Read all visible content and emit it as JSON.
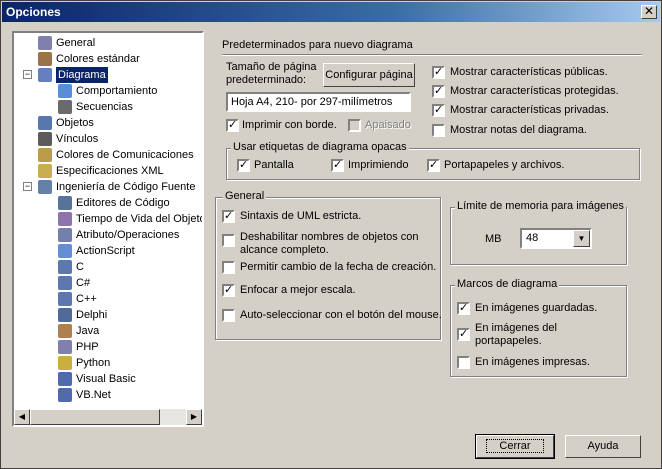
{
  "window": {
    "title": "Opciones",
    "close_glyph": "✕"
  },
  "tree": {
    "items": [
      {
        "label": "General",
        "icon": "general-icon"
      },
      {
        "label": "Colores estándar",
        "icon": "colors-icon"
      },
      {
        "label": "Diagrama",
        "icon": "diagram-icon"
      },
      {
        "label": "Comportamiento",
        "icon": "behavior-icon"
      },
      {
        "label": "Secuencias",
        "icon": "sequence-icon"
      },
      {
        "label": "Objetos",
        "icon": "objects-icon"
      },
      {
        "label": "Vínculos",
        "icon": "links-icon"
      },
      {
        "label": "Colores de Comunicaciones",
        "icon": "comm-colors-icon"
      },
      {
        "label": "Especificaciones XML",
        "icon": "xml-icon"
      },
      {
        "label": "Ingeniería de Código Fuente",
        "icon": "code-eng-icon"
      },
      {
        "label": "Editores de Código",
        "icon": "code-editor-icon"
      },
      {
        "label": "Tiempo de Vida del Objeto",
        "icon": "lifetime-icon"
      },
      {
        "label": "Atributo/Operaciones",
        "icon": "attributes-icon"
      },
      {
        "label": "ActionScript",
        "icon": "actionscript-icon"
      },
      {
        "label": "C",
        "icon": "c-icon"
      },
      {
        "label": "C#",
        "icon": "csharp-icon"
      },
      {
        "label": "C++",
        "icon": "cpp-icon"
      },
      {
        "label": "Delphi",
        "icon": "delphi-icon"
      },
      {
        "label": "Java",
        "icon": "java-icon"
      },
      {
        "label": "PHP",
        "icon": "php-icon"
      },
      {
        "label": "Python",
        "icon": "python-icon"
      },
      {
        "label": "Visual Basic",
        "icon": "vb-icon"
      },
      {
        "label": "VB.Net",
        "icon": "vbnet-icon"
      }
    ],
    "expand_minus": "−",
    "scroll_left": "◀",
    "scroll_right": "▶"
  },
  "defaults": {
    "heading": "Predeterminados para nuevo diagrama",
    "page_size_label": "Tamaño de página predeterminado:",
    "configure_button": "Configurar página",
    "page_size_value": "Hoja A4, 210- por 297-milímetros",
    "print_border": {
      "label": "Imprimir con borde.",
      "checked": true
    },
    "opaque": {
      "label": "Apaisado",
      "checked": false
    },
    "public": {
      "label": "Mostrar características públicas.",
      "checked": true
    },
    "protected": {
      "label": "Mostrar características protegidas.",
      "checked": true
    },
    "private": {
      "label": "Mostrar características privadas.",
      "checked": true
    },
    "notes": {
      "label": "Mostrar notas del diagrama.",
      "checked": false
    }
  },
  "labels_group": {
    "legend": "Usar etiquetas de diagrama opacas",
    "screen": {
      "label": "Pantalla",
      "checked": true
    },
    "printing": {
      "label": "Imprimiendo",
      "checked": true
    },
    "clipboard": {
      "label": "Portapapeles y archivos.",
      "checked": true
    }
  },
  "general_group": {
    "legend": "General",
    "strict_uml": {
      "label": "Sintaxis de UML estricta.",
      "checked": true
    },
    "disable_full_names": {
      "label": "Deshabilitar nombres de objetos con alcance completo.",
      "checked": false
    },
    "allow_date_change": {
      "label": "Permitir cambio de la fecha de creación.",
      "checked": false
    },
    "focus_scale": {
      "label": "Enfocar a mejor escala.",
      "checked": true
    },
    "auto_select": {
      "label": "Auto-seleccionar con el botón del mouse.",
      "checked": false
    }
  },
  "memory_group": {
    "legend": "Límite de memoria para imágenes",
    "unit": "MB",
    "value": "48",
    "arrow": "▼"
  },
  "frames_group": {
    "legend": "Marcos de diagrama",
    "saved": {
      "label": "En imágenes guardadas.",
      "checked": true
    },
    "clipboard": {
      "label": "En imágenes del portapapeles.",
      "checked": true
    },
    "printed": {
      "label": "En imágenes impresas.",
      "checked": false
    }
  },
  "buttons": {
    "close": "Cerrar",
    "help": "Ayuda"
  },
  "check_glyph": "✓"
}
